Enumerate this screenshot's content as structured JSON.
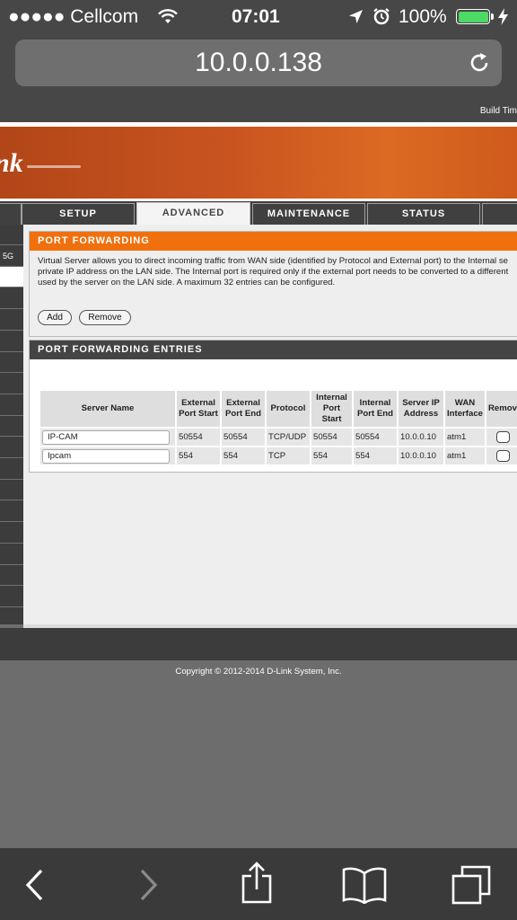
{
  "status_bar": {
    "carrier": "●●●●● Cellcom",
    "time": "07:01",
    "battery": "100%"
  },
  "browser": {
    "url": "10.0.0.138",
    "build_time": "Build Tim"
  },
  "router": {
    "logo": "nk",
    "tabs": [
      "SETUP",
      "ADVANCED",
      "MAINTENANCE",
      "STATUS"
    ],
    "active_tab": "ADVANCED",
    "left_nav_visible_label": "5G",
    "port_forwarding": {
      "title": "PORT FORWARDING",
      "description_lines": [
        "Virtual Server allows you to direct incoming traffic from WAN side (identified by Protocol and External port) to the Internal se",
        "private IP address on the LAN side. The Internal port is required only if the external port needs to be converted to a different",
        "used by the server on the LAN side. A maximum 32 entries can be configured."
      ],
      "add_label": "Add",
      "remove_label": "Remove"
    },
    "entries": {
      "title": "PORT FORWARDING ENTRIES",
      "headers": [
        [
          "Server Name"
        ],
        [
          "External",
          "Port Start"
        ],
        [
          "External",
          "Port End"
        ],
        [
          "Protocol"
        ],
        [
          "Internal",
          "Port",
          "Start"
        ],
        [
          "Internal",
          "Port End"
        ],
        [
          "Server IP",
          "Address"
        ],
        [
          "WAN",
          "Interface"
        ],
        [
          "Remov"
        ]
      ],
      "rows": [
        {
          "name": "IP-CAM",
          "ext_start": "50554",
          "ext_end": "50554",
          "protocol": "TCP/UDP",
          "int_start": "50554",
          "int_end": "50554",
          "server_ip": "10.0.0.10",
          "wan": "atm1"
        },
        {
          "name": "Ipcam",
          "ext_start": "554",
          "ext_end": "554",
          "protocol": "TCP",
          "int_start": "554",
          "int_end": "554",
          "server_ip": "10.0.0.10",
          "wan": "atm1"
        }
      ]
    },
    "copyright": "Copyright © 2012-2014 D-Link System, Inc."
  },
  "icons": {
    "status_bar": [
      "wifi-icon",
      "location-arrow-icon",
      "alarm-icon",
      "battery-icon",
      "charging-bolt-icon"
    ],
    "browser": [
      "reload-icon"
    ],
    "toolbar": [
      "back-arrow-icon",
      "forward-arrow-icon",
      "share-icon",
      "bookmarks-icon",
      "tabs-icon"
    ]
  },
  "colors": {
    "accent_orange": "#f0700e",
    "battery_green": "#4cd964"
  }
}
